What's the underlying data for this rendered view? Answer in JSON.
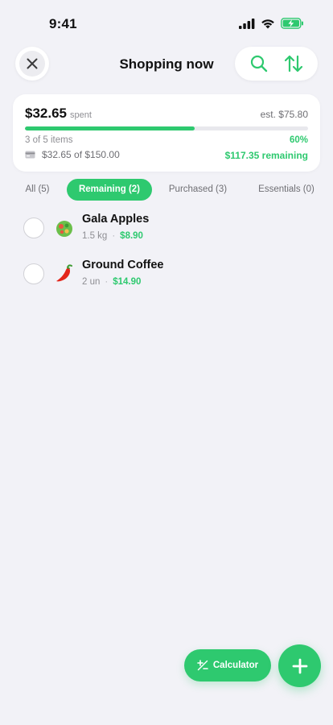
{
  "status_bar": {
    "time": "9:41"
  },
  "header": {
    "title": "Shopping now",
    "icons": {
      "close": "close-icon",
      "search": "search-icon",
      "sort": "sort-arrows-icon"
    }
  },
  "summary": {
    "spent_amount": "$32.65",
    "spent_label": "spent",
    "estimate": "est. $75.80",
    "items_progress": "3 of 5 items",
    "percent": "60%",
    "progress_fraction": 0.6,
    "budget": "$32.65 of $150.00",
    "remaining": "$117.35 remaining"
  },
  "tabs": [
    {
      "label": "All (5)",
      "active": false
    },
    {
      "label": "Remaining (2)",
      "active": true
    },
    {
      "label": "Purchased (3)",
      "active": false
    },
    {
      "label": "Essentials (0)",
      "active": false
    }
  ],
  "items": [
    {
      "name": "Gala Apples",
      "quantity": "1.5 kg",
      "price": "$8.90",
      "icon": "salad-icon"
    },
    {
      "name": "Ground Coffee",
      "quantity": "2 un",
      "price": "$14.90",
      "icon": "chili-pepper-icon"
    }
  ],
  "actions": {
    "calculator_label": "Calculator"
  },
  "colors": {
    "accent": "#2ec96f",
    "background": "#f2f2f7"
  }
}
